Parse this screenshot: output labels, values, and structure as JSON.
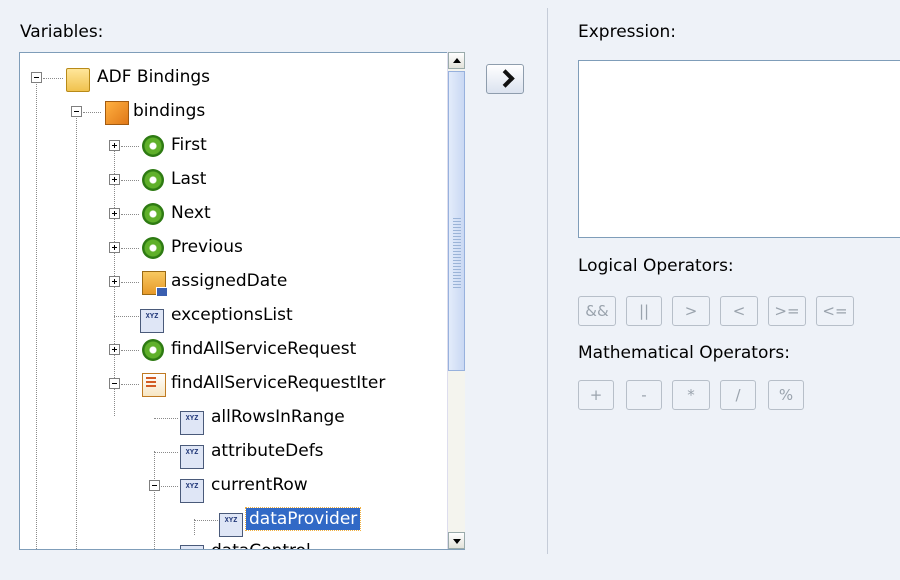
{
  "variables_label": "Variables:",
  "expression_label": "Expression:",
  "logical_label": "Logical Operators:",
  "math_label": "Mathematical Operators:",
  "logical_operators": [
    "&&",
    "||",
    ">",
    "<",
    ">=",
    "<="
  ],
  "math_operators": [
    "+",
    "-",
    "*",
    "/",
    "%"
  ],
  "tree": [
    {
      "label": "ADF Bindings",
      "icon": "folder-icon"
    },
    {
      "label": "bindings",
      "icon": "binding-container-icon"
    },
    {
      "label": "First",
      "icon": "action-gear-icon"
    },
    {
      "label": "Last",
      "icon": "action-gear-icon"
    },
    {
      "label": "Next",
      "icon": "action-gear-icon"
    },
    {
      "label": "Previous",
      "icon": "action-gear-icon"
    },
    {
      "label": "assignedDate",
      "icon": "attribute-binding-icon"
    },
    {
      "label": "exceptionsList",
      "icon": "xyz-icon"
    },
    {
      "label": "findAllServiceRequest",
      "icon": "action-gear-icon"
    },
    {
      "label": "findAllServiceRequestIter",
      "icon": "iterator-icon"
    },
    {
      "label": "allRowsInRange",
      "icon": "xyz-icon"
    },
    {
      "label": "attributeDefs",
      "icon": "xyz-icon"
    },
    {
      "label": "currentRow",
      "icon": "xyz-icon"
    },
    {
      "label": "dataProvider",
      "icon": "xyz-icon"
    },
    {
      "label": "dataControl",
      "icon": "xyz-icon"
    }
  ]
}
